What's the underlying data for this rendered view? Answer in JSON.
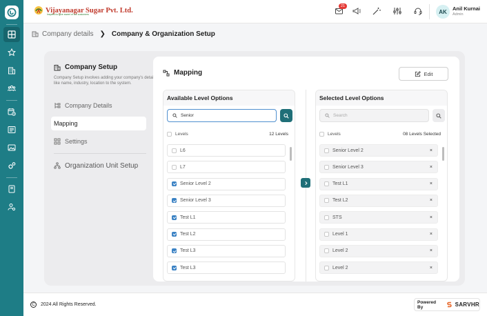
{
  "app": {
    "brand_name": "Vijayanagar Sugar Pvt. Ltd.",
    "brand_tagline": "Inspired to give sweet of our customers",
    "notification_count": "21"
  },
  "rail": {
    "icons": [
      "dashboard-icon",
      "star-icon",
      "building-icon",
      "team-icon",
      "calendar-clock-icon",
      "document-icon",
      "image-icon",
      "gears-icon",
      "book-icon",
      "user-settings-icon"
    ]
  },
  "user": {
    "initials": "AK",
    "name": "Anil Kurnai",
    "role": "Admin"
  },
  "breadcrumb": {
    "parent": "Company details",
    "current": "Company & Organization Setup"
  },
  "sidebar": {
    "title": "Company Setup",
    "description": "Company Setup involves adding your company's details like name, industry, location to the system.",
    "items": [
      {
        "label": "Company Details"
      },
      {
        "label": "Mapping"
      },
      {
        "label": "Settings"
      }
    ],
    "org_unit_label": "Organization Unit Setup"
  },
  "mapping": {
    "title": "Mapping",
    "edit_label": "Edit",
    "available": {
      "heading": "Available Level Options",
      "search_value": "Senior",
      "levels_label": "Levels",
      "count_label": "12 Levels",
      "rows": [
        {
          "label": "L6",
          "checked": false
        },
        {
          "label": "L7",
          "checked": false
        },
        {
          "label": "Senior Level 2",
          "checked": true
        },
        {
          "label": "Senior Level 3",
          "checked": true
        },
        {
          "label": "Test L1",
          "checked": true
        },
        {
          "label": "Test L2",
          "checked": true
        },
        {
          "label": "Test L3",
          "checked": true
        },
        {
          "label": "Test L3",
          "checked": true
        }
      ]
    },
    "selected": {
      "heading": "Selected Level Options",
      "search_placeholder": "Search",
      "levels_label": "Levels",
      "count_label": "08 Levels Selected",
      "remove_symbol": "×",
      "rows": [
        {
          "label": "Senior Level 2"
        },
        {
          "label": "Senior Level 3"
        },
        {
          "label": "Test L1"
        },
        {
          "label": "Test L2"
        },
        {
          "label": "STS"
        },
        {
          "label": "Level 1"
        },
        {
          "label": "Level 2"
        },
        {
          "label": "Level 2"
        }
      ]
    }
  },
  "footer": {
    "copyright_symbol": "C",
    "copyright_text": "2024 All Rights Reserved.",
    "powered_label": "Powered By",
    "powered_brand": "SARVHR"
  },
  "colors": {
    "accent": "#1e7d86",
    "accent_dark": "#1f6f78",
    "check": "#3b82c4",
    "badge": "#e53935"
  }
}
